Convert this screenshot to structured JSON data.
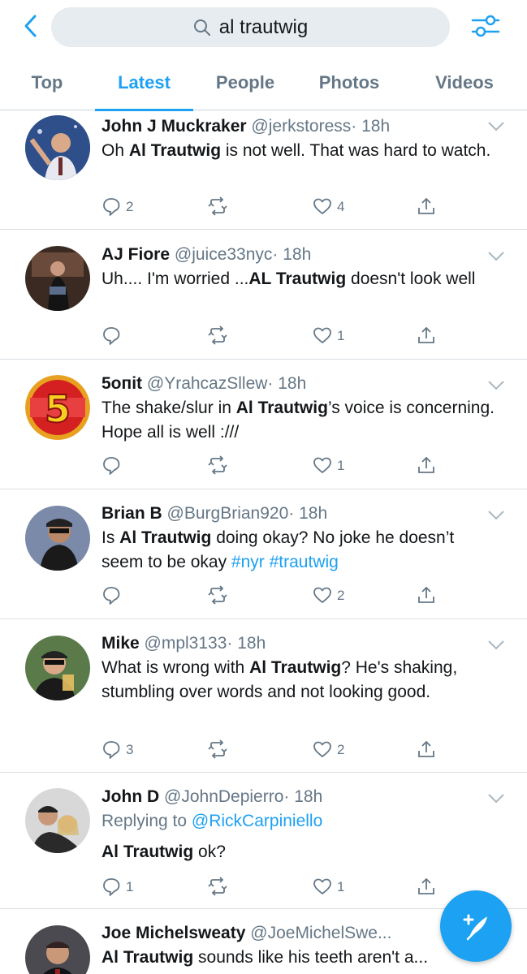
{
  "search": {
    "query": "al trautwig"
  },
  "tabs": [
    {
      "label": "Top",
      "active": false
    },
    {
      "label": "Latest",
      "active": true
    },
    {
      "label": "People",
      "active": false
    },
    {
      "label": "Photos",
      "active": false
    },
    {
      "label": "Videos",
      "active": false
    }
  ],
  "colors": {
    "accent": "#1da1f2",
    "muted": "#657786",
    "text": "#14171a",
    "search_bg": "#e6ecf0"
  },
  "tweets": [
    {
      "name": "John J Muckraker",
      "handle": "@jerkstoress",
      "time": "· 18h",
      "text_parts": [
        {
          "t": "Oh "
        },
        {
          "t": "Al Trautwig",
          "b": true
        },
        {
          "t": " is not well. That was hard to watch."
        }
      ],
      "replies": "2",
      "retweets": "",
      "likes": "4"
    },
    {
      "name": "AJ Fiore",
      "handle": "@juice33nyc",
      "time": "· 18h",
      "text_parts": [
        {
          "t": "Uh.... I'm worried ..."
        },
        {
          "t": "AL Trautwig",
          "b": true
        },
        {
          "t": " doesn't look well"
        }
      ],
      "replies": "",
      "retweets": "",
      "likes": "1"
    },
    {
      "name": "5oпit",
      "handle": "@YrahcazSllew",
      "time": "· 18h",
      "text_parts": [
        {
          "t": "The shake/slur in "
        },
        {
          "t": "Al Trautwig",
          "b": true
        },
        {
          "t": "’s voice is concerning. Hope all is well :///"
        }
      ],
      "replies": "",
      "retweets": "",
      "likes": "1"
    },
    {
      "name": "Brian B",
      "handle": "@BurgBrian920",
      "time": "· 18h",
      "text_parts": [
        {
          "t": "Is "
        },
        {
          "t": "Al Trautwig",
          "b": true
        },
        {
          "t": " doing okay? No joke he doesn’t seem to be okay "
        },
        {
          "t": "#nyr",
          "h": true
        },
        {
          "t": " "
        },
        {
          "t": "#trautwig",
          "h": true
        }
      ],
      "replies": "",
      "retweets": "",
      "likes": "2"
    },
    {
      "name": "Mike",
      "handle": "@mpl3133",
      "time": "· 18h",
      "text_parts": [
        {
          "t": "What is wrong with "
        },
        {
          "t": "Al Trautwig",
          "b": true
        },
        {
          "t": "?  He's shaking, stumbling over words and not looking good."
        }
      ],
      "replies": "3",
      "retweets": "",
      "likes": "2"
    },
    {
      "name": "John D",
      "handle": "@JohnDepierro",
      "time": "· 18h",
      "reply_prefix": "Replying to ",
      "reply_to": "@RickCarpiniello",
      "text_parts": [
        {
          "t": "Al Trautwig",
          "b": true
        },
        {
          "t": " ok?"
        }
      ],
      "replies": "1",
      "retweets": "",
      "likes": "1"
    },
    {
      "name": "Joe Michelsweaty",
      "handle": "@JoeMichelSwe...",
      "time": "",
      "text_parts": [
        {
          "t": "Al Trautwig",
          "b": true
        },
        {
          "t": " sounds like his teeth aren't a..."
        }
      ],
      "replies": "",
      "retweets": "",
      "likes": ""
    }
  ]
}
